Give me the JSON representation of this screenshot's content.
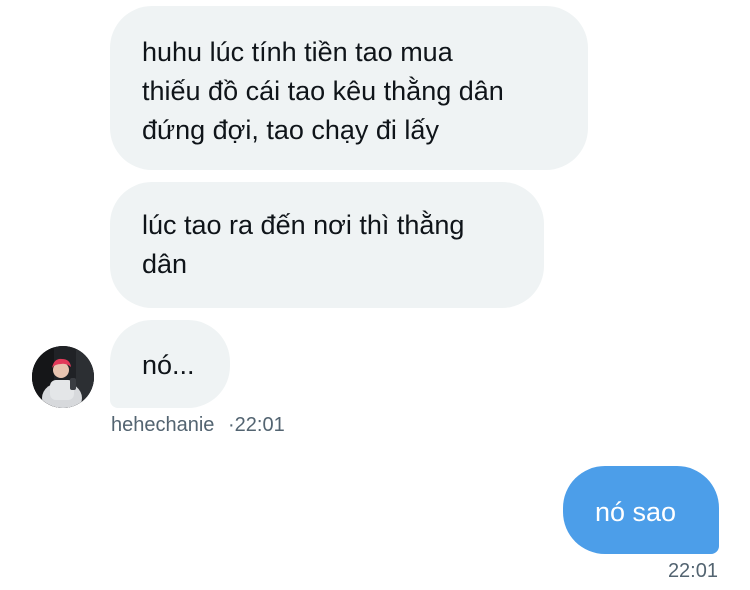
{
  "conversation": {
    "messages": [
      {
        "sender": "hehechanie",
        "direction": "incoming",
        "text": "huhu lúc tính tiền tao mua\nthiếu đồ cái tao kêu thằng dân\nđứng đợi, tao chạy đi lấy"
      },
      {
        "sender": "hehechanie",
        "direction": "incoming",
        "text": "lúc tao ra đến nơi thì thằng\ndân"
      },
      {
        "sender": "hehechanie",
        "direction": "incoming",
        "text": "nó..."
      },
      {
        "sender": "me",
        "direction": "outgoing",
        "text": "nó sao"
      }
    ],
    "incoming_meta": {
      "username": "hehechanie",
      "separator": "·",
      "time": "22:01"
    },
    "outgoing_meta": {
      "time": "22:01"
    }
  },
  "icons": {
    "avatar": "user-avatar-photo"
  },
  "colors": {
    "incoming_bubble": "#eff3f4",
    "outgoing_bubble": "#4c9ee9",
    "meta_text": "#536471"
  }
}
